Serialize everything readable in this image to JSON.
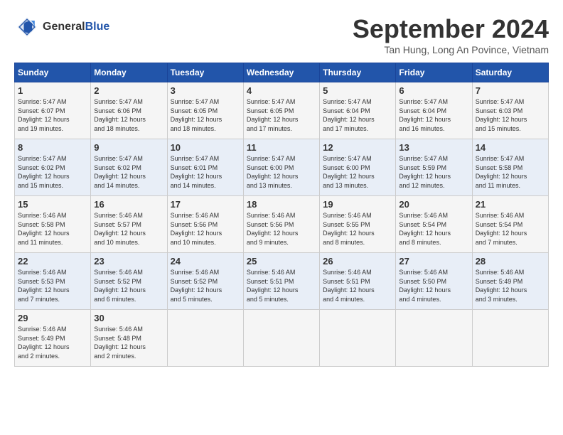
{
  "header": {
    "logo_line1": "General",
    "logo_line2": "Blue",
    "month_title": "September 2024",
    "location": "Tan Hung, Long An Povince, Vietnam"
  },
  "calendar": {
    "days_of_week": [
      "Sunday",
      "Monday",
      "Tuesday",
      "Wednesday",
      "Thursday",
      "Friday",
      "Saturday"
    ],
    "weeks": [
      [
        {
          "day": "",
          "info": ""
        },
        {
          "day": "2",
          "info": "Sunrise: 5:47 AM\nSunset: 6:06 PM\nDaylight: 12 hours\nand 18 minutes."
        },
        {
          "day": "3",
          "info": "Sunrise: 5:47 AM\nSunset: 6:05 PM\nDaylight: 12 hours\nand 18 minutes."
        },
        {
          "day": "4",
          "info": "Sunrise: 5:47 AM\nSunset: 6:05 PM\nDaylight: 12 hours\nand 17 minutes."
        },
        {
          "day": "5",
          "info": "Sunrise: 5:47 AM\nSunset: 6:04 PM\nDaylight: 12 hours\nand 17 minutes."
        },
        {
          "day": "6",
          "info": "Sunrise: 5:47 AM\nSunset: 6:04 PM\nDaylight: 12 hours\nand 16 minutes."
        },
        {
          "day": "7",
          "info": "Sunrise: 5:47 AM\nSunset: 6:03 PM\nDaylight: 12 hours\nand 15 minutes."
        }
      ],
      [
        {
          "day": "1",
          "info": "Sunrise: 5:47 AM\nSunset: 6:07 PM\nDaylight: 12 hours\nand 19 minutes."
        },
        {
          "day": "",
          "info": ""
        },
        {
          "day": "",
          "info": ""
        },
        {
          "day": "",
          "info": ""
        },
        {
          "day": "",
          "info": ""
        },
        {
          "day": "",
          "info": ""
        },
        {
          "day": "",
          "info": ""
        }
      ],
      [
        {
          "day": "8",
          "info": "Sunrise: 5:47 AM\nSunset: 6:02 PM\nDaylight: 12 hours\nand 15 minutes."
        },
        {
          "day": "9",
          "info": "Sunrise: 5:47 AM\nSunset: 6:02 PM\nDaylight: 12 hours\nand 14 minutes."
        },
        {
          "day": "10",
          "info": "Sunrise: 5:47 AM\nSunset: 6:01 PM\nDaylight: 12 hours\nand 14 minutes."
        },
        {
          "day": "11",
          "info": "Sunrise: 5:47 AM\nSunset: 6:00 PM\nDaylight: 12 hours\nand 13 minutes."
        },
        {
          "day": "12",
          "info": "Sunrise: 5:47 AM\nSunset: 6:00 PM\nDaylight: 12 hours\nand 13 minutes."
        },
        {
          "day": "13",
          "info": "Sunrise: 5:47 AM\nSunset: 5:59 PM\nDaylight: 12 hours\nand 12 minutes."
        },
        {
          "day": "14",
          "info": "Sunrise: 5:47 AM\nSunset: 5:58 PM\nDaylight: 12 hours\nand 11 minutes."
        }
      ],
      [
        {
          "day": "15",
          "info": "Sunrise: 5:46 AM\nSunset: 5:58 PM\nDaylight: 12 hours\nand 11 minutes."
        },
        {
          "day": "16",
          "info": "Sunrise: 5:46 AM\nSunset: 5:57 PM\nDaylight: 12 hours\nand 10 minutes."
        },
        {
          "day": "17",
          "info": "Sunrise: 5:46 AM\nSunset: 5:56 PM\nDaylight: 12 hours\nand 10 minutes."
        },
        {
          "day": "18",
          "info": "Sunrise: 5:46 AM\nSunset: 5:56 PM\nDaylight: 12 hours\nand 9 minutes."
        },
        {
          "day": "19",
          "info": "Sunrise: 5:46 AM\nSunset: 5:55 PM\nDaylight: 12 hours\nand 8 minutes."
        },
        {
          "day": "20",
          "info": "Sunrise: 5:46 AM\nSunset: 5:54 PM\nDaylight: 12 hours\nand 8 minutes."
        },
        {
          "day": "21",
          "info": "Sunrise: 5:46 AM\nSunset: 5:54 PM\nDaylight: 12 hours\nand 7 minutes."
        }
      ],
      [
        {
          "day": "22",
          "info": "Sunrise: 5:46 AM\nSunset: 5:53 PM\nDaylight: 12 hours\nand 7 minutes."
        },
        {
          "day": "23",
          "info": "Sunrise: 5:46 AM\nSunset: 5:52 PM\nDaylight: 12 hours\nand 6 minutes."
        },
        {
          "day": "24",
          "info": "Sunrise: 5:46 AM\nSunset: 5:52 PM\nDaylight: 12 hours\nand 5 minutes."
        },
        {
          "day": "25",
          "info": "Sunrise: 5:46 AM\nSunset: 5:51 PM\nDaylight: 12 hours\nand 5 minutes."
        },
        {
          "day": "26",
          "info": "Sunrise: 5:46 AM\nSunset: 5:51 PM\nDaylight: 12 hours\nand 4 minutes."
        },
        {
          "day": "27",
          "info": "Sunrise: 5:46 AM\nSunset: 5:50 PM\nDaylight: 12 hours\nand 4 minutes."
        },
        {
          "day": "28",
          "info": "Sunrise: 5:46 AM\nSunset: 5:49 PM\nDaylight: 12 hours\nand 3 minutes."
        }
      ],
      [
        {
          "day": "29",
          "info": "Sunrise: 5:46 AM\nSunset: 5:49 PM\nDaylight: 12 hours\nand 2 minutes."
        },
        {
          "day": "30",
          "info": "Sunrise: 5:46 AM\nSunset: 5:48 PM\nDaylight: 12 hours\nand 2 minutes."
        },
        {
          "day": "",
          "info": ""
        },
        {
          "day": "",
          "info": ""
        },
        {
          "day": "",
          "info": ""
        },
        {
          "day": "",
          "info": ""
        },
        {
          "day": "",
          "info": ""
        }
      ]
    ]
  }
}
